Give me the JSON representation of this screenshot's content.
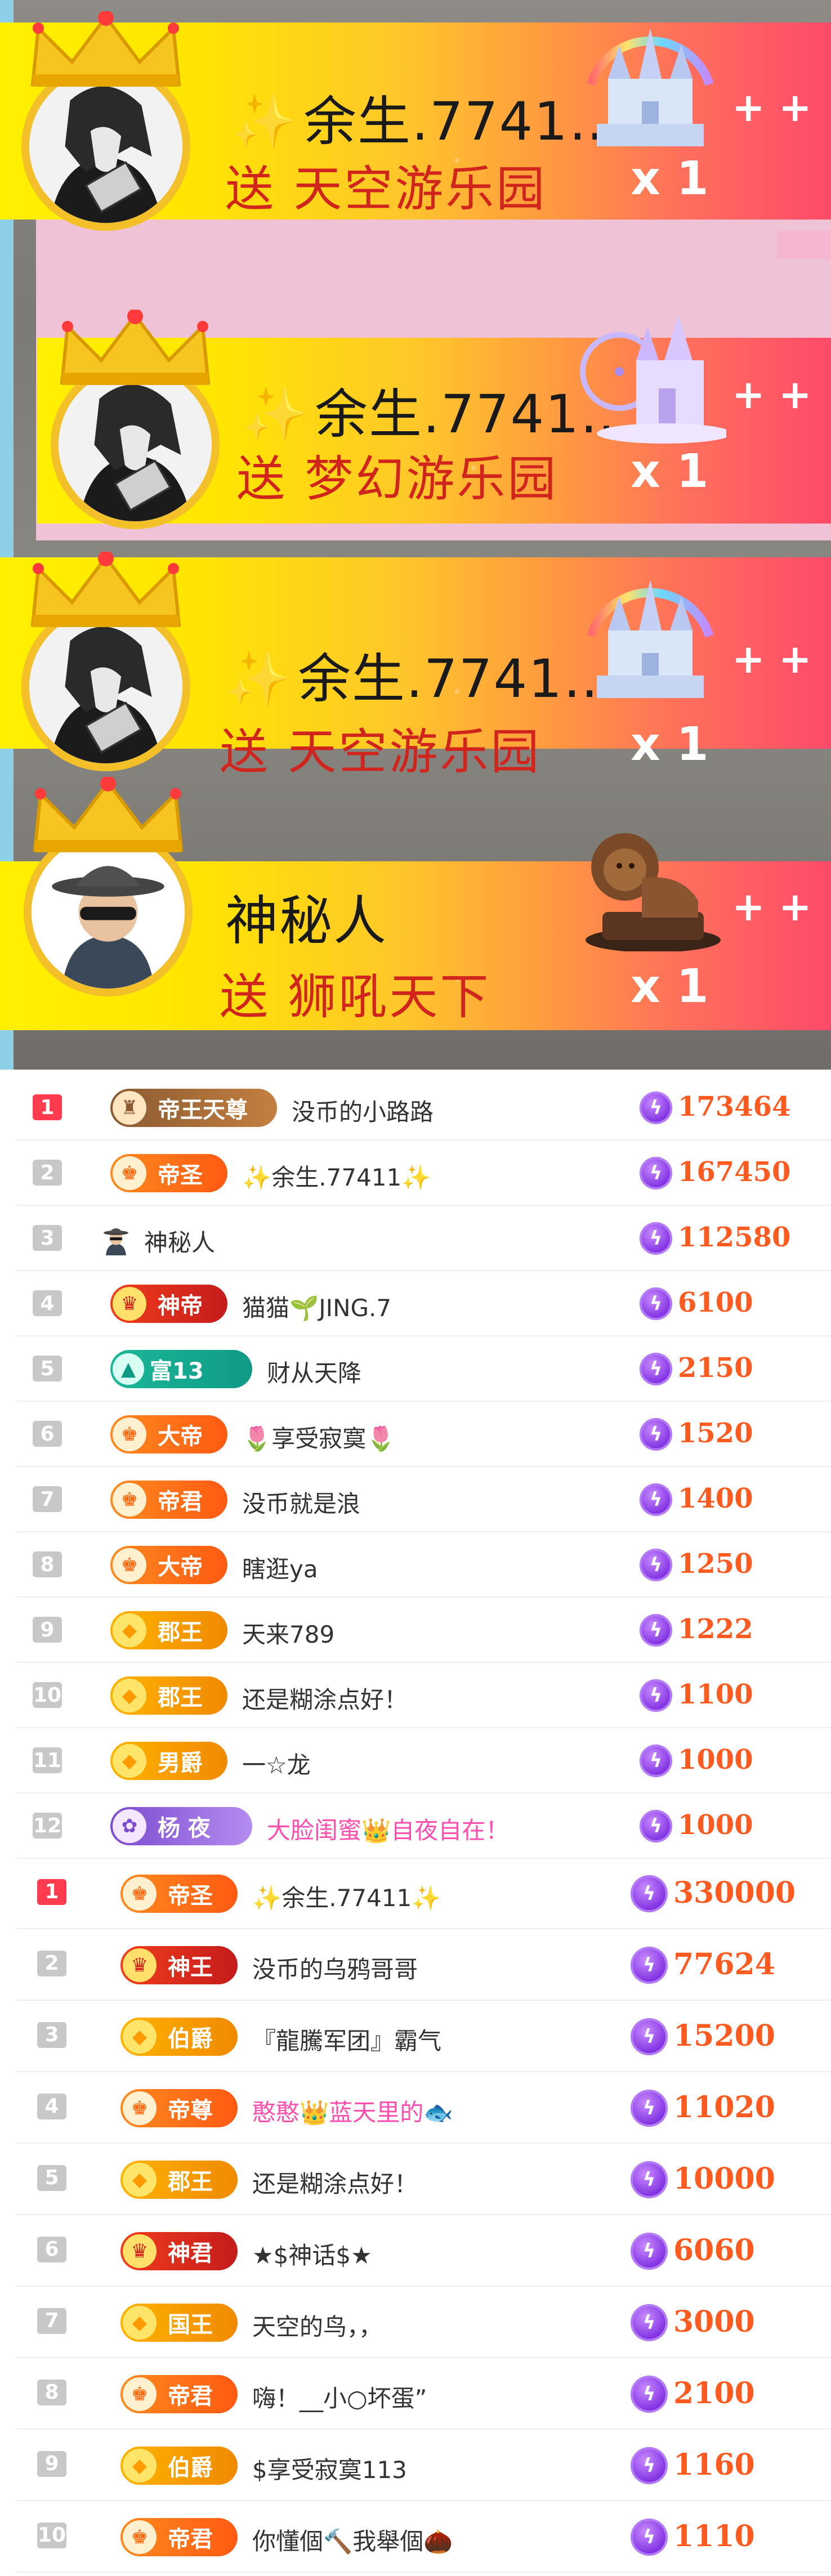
{
  "gift_feed": [
    {
      "name": "余生.7741…",
      "action": "送 天空游乐园",
      "count": "x 1",
      "image_icon": "castle-rainbow-icon"
    },
    {
      "name": "余生.7741…",
      "action": "送 梦幻游乐园",
      "count": "x 1",
      "image_icon": "dream-castle-icon"
    },
    {
      "name": "余生.7741…",
      "action": "送 天空游乐园",
      "count": "x 1",
      "image_icon": "castle-rainbow-icon"
    },
    {
      "name": "神秘人",
      "action": "送 狮吼天下",
      "count": "x 1",
      "image_icon": "lion-statue-icon"
    }
  ],
  "leaderboard_1": [
    {
      "rank": "1",
      "badge": "帝王天尊",
      "name": "没币的小路路",
      "score": "173464"
    },
    {
      "rank": "2",
      "badge": "帝圣",
      "name": "✨余生.77411✨",
      "score": "167450"
    },
    {
      "rank": "3",
      "badge": "",
      "name": "神秘人",
      "score": "112580"
    },
    {
      "rank": "4",
      "badge": "神帝",
      "name": "猫猫🌱JING.7",
      "score": "6100"
    },
    {
      "rank": "5",
      "badge": "富13",
      "name": "财从天降",
      "score": "2150"
    },
    {
      "rank": "6",
      "badge": "大帝",
      "name": "🌷享受寂寞🌷",
      "score": "1520"
    },
    {
      "rank": "7",
      "badge": "帝君",
      "name": "没币就是浪",
      "score": "1400"
    },
    {
      "rank": "8",
      "badge": "大帝",
      "name": "瞎逛ya",
      "score": "1250"
    },
    {
      "rank": "9",
      "badge": "郡王",
      "name": "天来789",
      "score": "1222"
    },
    {
      "rank": "10",
      "badge": "郡王",
      "name": "还是糊涂点好！",
      "score": "1100"
    },
    {
      "rank": "11",
      "badge": "男爵",
      "name": "一☆龙",
      "score": "1000"
    },
    {
      "rank": "12",
      "badge": "杨 夜",
      "name": "大脸闺蜜👑自夜自在！",
      "score": "1000"
    }
  ],
  "leaderboard_2": [
    {
      "rank": "1",
      "badge": "帝圣",
      "name": "✨余生.77411✨",
      "score": "330000"
    },
    {
      "rank": "2",
      "badge": "神王",
      "name": "没币的乌鸦哥哥",
      "score": "77624"
    },
    {
      "rank": "3",
      "badge": "伯爵",
      "name": "『龍騰军团』霸气",
      "score": "15200"
    },
    {
      "rank": "4",
      "badge": "帝尊",
      "name": "憨憨👑蓝天里的🐟",
      "score": "11020"
    },
    {
      "rank": "5",
      "badge": "郡王",
      "name": "还是糊涂点好！",
      "score": "10000"
    },
    {
      "rank": "6",
      "badge": "神君",
      "name": "★$神话$★",
      "score": "6060"
    },
    {
      "rank": "7",
      "badge": "国王",
      "name": "天空的鸟，，",
      "score": "3000"
    },
    {
      "rank": "8",
      "badge": "帝君",
      "name": "嗨！__小○坏蛋”",
      "score": "2100"
    },
    {
      "rank": "9",
      "badge": "伯爵",
      "name": "$享受寂寞113",
      "score": "1160"
    },
    {
      "rank": "10",
      "badge": "帝君",
      "name": "你懂個🔨我舉個🌰",
      "score": "1110"
    }
  ]
}
